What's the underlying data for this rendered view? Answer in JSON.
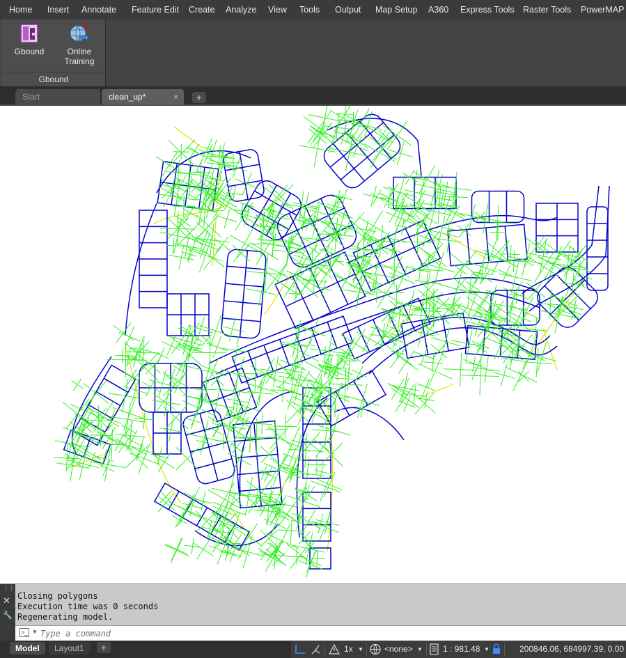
{
  "menu": {
    "items": [
      "Home",
      "Insert",
      "Annotate",
      "Feature Edit",
      "Create",
      "Analyze",
      "View",
      "Tools",
      "Output",
      "Map Setup",
      "A360",
      "Express Tools",
      "Raster Tools",
      "PowerMAP"
    ]
  },
  "ribbon": {
    "panel_title": "Gbound",
    "buttons": [
      {
        "label": "Gbound",
        "icon": "gbound-icon"
      },
      {
        "label_line1": "Online",
        "label_line2": "Training",
        "icon": "online-training-icon"
      }
    ]
  },
  "file_tabs": {
    "start": "Start",
    "active": "clean_up*",
    "close_glyph": "×",
    "add_glyph": "+"
  },
  "colors": {
    "parcel_lines": "#0000cc",
    "topology_marks": "#33ee22",
    "centerlines": "#e8e000",
    "ribbon_bg": "#444444",
    "command_bg": "#c9c9c9"
  },
  "command": {
    "history": [
      "Closing polygons",
      "Execution time was 0 seconds",
      "Regenerating model."
    ],
    "placeholder": "Type a command",
    "close_glyph": "✕",
    "settings_glyph": "🔧"
  },
  "status": {
    "layout_tabs": [
      "Model",
      "Layout1"
    ],
    "add_glyph": "+",
    "annotation_scale": "1x",
    "workspace": "<none>",
    "scale": "1 : 981.48",
    "coordinates": "200846.06, 684997.39, 0.00"
  }
}
